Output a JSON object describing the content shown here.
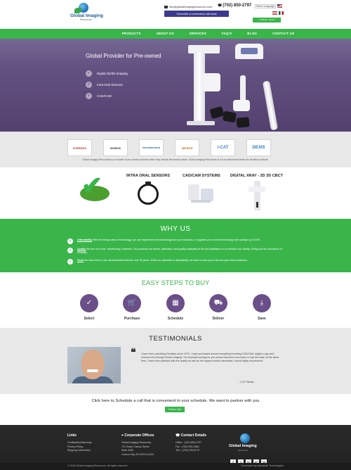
{
  "header": {
    "logo_text": "Global Imaging",
    "logo_sub": "Resources",
    "email": "info@globalimagingresources.com",
    "phone": "(702) 850-2797",
    "schedule_label": "Schedule a convenient call back",
    "language": "Select Language",
    "cart_label": "0 ITEMS - $0.00"
  },
  "nav": [
    "PRODUCTS",
    "ABOUT US",
    "SERVICES",
    "FAQ'S",
    "BLOG",
    "CONTACT US"
  ],
  "hero": {
    "title": "Global Provider for Pre-owned",
    "items": [
      "Digital 2D/3D Imaging",
      "Intra-Oral Sensors",
      "CAD/CAM"
    ],
    "bg_color": "#5c4877"
  },
  "brands": {
    "logos": [
      {
        "name": "SOREDEX",
        "color": "#c0392b"
      },
      {
        "name": "SCHICK",
        "color": "#222222"
      },
      {
        "name": "INSTRUMENTARIUM",
        "color": "#1f5d99"
      },
      {
        "name": "VATECH",
        "color": "#d35400"
      },
      {
        "name": "i-CAT",
        "color": "#3a7bc8"
      },
      {
        "name": "DEXIS",
        "color": "#2b7cb3"
      }
    ],
    "disclaimer": "Global Imaging Resources is a re-seller of pre-owned products which may include the brands above. Global Imaging Resources is not an authorized dealer for all listed products."
  },
  "products": {
    "titles": [
      "INTRA ORAL SENSORS",
      "CAD/CAM SYSTEMS",
      "DIGITAL XRAY - 2D 3D CBCT"
    ]
  },
  "why_us": {
    "title": "WHY US",
    "rows": [
      {
        "term": "Affordability",
        "text": " With the rising costs of technology, you can implement new technology into your business, or upgrade your current technology with savings up to 60%."
      },
      {
        "term": "Quality",
        "text": " We are not in the \"refurbishing\" business. Our products are tested, calibrated, and quality evaluated at the de-installation or on arrival to our facility. Giving you the assurance of reliability."
      },
      {
        "term": "Trust",
        "text": " We have been in the medical/dental field for over 30 years.  While our attraction is affordability, we work to earn your trust and your future business."
      }
    ],
    "color": "#3ab54a"
  },
  "steps": {
    "title": "EASY STEPS TO BUY",
    "items": [
      {
        "label": "Select",
        "icon": "check-icon"
      },
      {
        "label": "Purchase",
        "icon": "cart-icon"
      },
      {
        "label": "Schedule",
        "icon": "calendar-icon"
      },
      {
        "label": "Deliver",
        "icon": "truck-icon"
      },
      {
        "label": "Save",
        "icon": "download-icon"
      }
    ],
    "circle_color": "#6b4f88"
  },
  "testimonials": {
    "title": "TESTIMONIALS",
    "text": "I have been practicing Dentistry since 1979. I have purchased almost everything including CAD/CAM, digital x-rays and sensors etc) through Global Imaging. The financial savings for pre-owned has been enormous, to say the least. At the same time, I have been pleased with the quality as well as the support and/or warranties I would highly recommend.",
    "author": "- C.H. Florida"
  },
  "cta": {
    "text": "Click here to Schedule a call that is convenient to your schedule. We want to partner with you",
    "button": "Return Call"
  },
  "footer": {
    "links_title": "Links",
    "links": [
      "Certification/Warranty",
      "Privacy Policy",
      "Shipping Information"
    ],
    "offices_title": "Corporate Offices",
    "offices": [
      "Global Imaging Resources",
      "701 South Carson Street",
      "Suite #200",
      "Carson City, NV 89701-5239"
    ],
    "contact_title": "Contact Details",
    "contact": [
      "Office : (702) 850-2797",
      "Fax    : (702) 939-2863",
      "Text   : (702) 939-6779"
    ],
    "logo_text": "Global Imaging",
    "logo_sub": "Resources",
    "socials": [
      "f",
      "t",
      "in",
      "g+",
      "yt"
    ],
    "copyright": "© 2018 Global Imaging Resources. All rights reserved",
    "developer": "Developed by Alamekak Technologies"
  }
}
